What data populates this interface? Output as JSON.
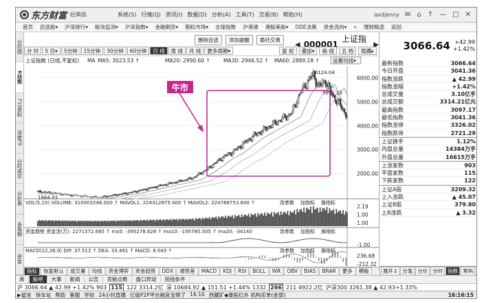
{
  "app": {
    "brand": "东方财富",
    "edition": "经典版",
    "menus": [
      "系统(S)",
      "行情(Q)",
      "资讯(I)",
      "数据(D)",
      "分析(A)",
      "工具(T)",
      "交易(B)",
      "帮助(H)"
    ],
    "user": "axdjenny",
    "window_controls": [
      "✉",
      "⌂",
      "↑",
      "—",
      "□",
      "✕"
    ]
  },
  "nav": [
    "首页",
    "自选股▾",
    "沪深排行▾",
    "板块监测▾",
    "沪深指数▾",
    "金融期货▾",
    "期权市场▾",
    "全球指数",
    "沪港通",
    "港股美股▾",
    "DDE决策",
    "资金流向▾",
    "»",
    "理财精选",
    "返回"
  ],
  "side_tabs": [
    "分时图",
    "K线图",
    "F10资料",
    "深度F9",
    "分时成交",
    "分价表",
    "多周期",
    "资金"
  ],
  "side_active": 1,
  "toolbar": {
    "buttons": [
      "删除自选",
      "添加提醒",
      "委托交易"
    ],
    "code": "000001",
    "name": "上证指数",
    "price": "3066.64",
    "change": "+42.99",
    "change_pct": "+1.42%"
  },
  "periods": [
    "分 时",
    "5 日▾",
    "5分钟",
    "15分钟",
    "30分钟",
    "60分钟",
    "日 线",
    "周 线",
    "月 线",
    "更多周期▾"
  ],
  "period_active": 6,
  "right_tools": [
    "复 权",
    "叠加▾",
    "画 线",
    "五 档",
    "隐藏▸"
  ],
  "chart": {
    "legend": {
      "title": "上证指数 (日线,不复权)",
      "ma": [
        "MA",
        "MA5: 3023.53 ↑",
        "MA10: 2964.54 ↑",
        "MA20: 2990.60 ↑",
        "MA30: 2946.52 ↑",
        "MA60: 2889.18 ↑"
      ],
      "setting": "设置均线▾"
    },
    "annotation": "牛市",
    "labels": {
      "high": "6124.04",
      "low": "1664.93",
      "mid": "5891.15"
    },
    "vol": {
      "legend": "VOL(5,10)",
      "volume": "VOLUME: 310003246.000 ↑",
      "mavol1": "MAVOL1: 224312875.400 ↑",
      "mavol2": "MAVOL2: 224788753.600 ↑",
      "buttons": [
        "改参数",
        "加指标",
        "换指标"
      ],
      "axis": [
        "2.19",
        "1.00",
        "1.00"
      ]
    },
    "fund": {
      "legend": "资金趋势",
      "line": "资金流(万): 2271572.685 ↑ ma5: -395278.628 ↑ ma10: -195785.505 ↑ ma20: -34140",
      "buttons": [
        "改参数",
        "加指标",
        "换指标"
      ],
      "axis": [
        "-1.00"
      ]
    },
    "macd": {
      "legend": "MACD(12,26,9)",
      "dif": "DIF: 37.512 ↑",
      "dea": "DEA: 33.491 ↑",
      "macd": "MACD: 8.043 ↑",
      "buttons": [
        "改参数",
        "加指标",
        "换指标"
      ],
      "axis": [
        "236.68",
        "-212.32"
      ]
    },
    "x_labels": [
      "2006",
      "2007",
      "2008"
    ]
  },
  "chart_data": {
    "type": "line",
    "title": "上证指数",
    "x_range": [
      "2005-01",
      "2008-02"
    ],
    "y_ticks": [
      2000,
      3000,
      4000,
      5000,
      6000
    ],
    "ylim": [
      1000,
      6500
    ],
    "series": [
      {
        "x": [
          0,
          0.05,
          0.1,
          0.15,
          0.2,
          0.25,
          0.3,
          0.35,
          0.4,
          0.45,
          0.5,
          0.55,
          0.6,
          0.63,
          0.66,
          0.7,
          0.74,
          0.78,
          0.82,
          0.85,
          0.87,
          0.89,
          0.91,
          0.93,
          0.95,
          0.97,
          1.0
        ],
        "values": [
          1250,
          1180,
          1100,
          1050,
          1000,
          1100,
          1200,
          1350,
          1500,
          1650,
          1800,
          2200,
          2700,
          2900,
          3200,
          3600,
          3900,
          4200,
          4500,
          5400,
          5800,
          6124,
          5600,
          5900,
          5300,
          5000,
          4400
        ]
      }
    ],
    "grid": true
  },
  "indicator_tabs": [
    "指标",
    "恢复默认",
    "成交量",
    "均线",
    "资金博弈",
    "资金趋势",
    "DDX",
    "顺势差",
    "MACD",
    "KDJ",
    "RSI",
    "BOLL",
    "WR",
    "OBV",
    "BIAS",
    "BRAR",
    "更多",
    "模板"
  ],
  "indicator_active": 0,
  "right_panel": {
    "stats1": [
      {
        "k": "最新指数",
        "v": "3066.64"
      },
      {
        "k": "今日开盘",
        "v": "3041.36"
      },
      {
        "k": "指数涨跌",
        "v": "▲ 42.99"
      },
      {
        "k": "指数涨幅",
        "v": "+1.42%"
      },
      {
        "k": "总成交量",
        "v": "3.10亿手"
      },
      {
        "k": "总成交额",
        "v": "3314.21亿元"
      },
      {
        "k": "最高指数",
        "v": "3097.17"
      },
      {
        "k": "最低指数",
        "v": "3041.36"
      },
      {
        "k": "指数涨停",
        "v": "3326.02"
      },
      {
        "k": "指数跌停",
        "v": "2721.29"
      }
    ],
    "stats2": [
      {
        "k": "上证换手",
        "v": "1.12%"
      },
      {
        "k": "内盘总量",
        "v": "14384万手"
      },
      {
        "k": "外盘总量",
        "v": "16615万手"
      }
    ],
    "stats3": [
      {
        "k": "上涨家数",
        "v": "903"
      },
      {
        "k": "平盘家数",
        "v": "115"
      },
      {
        "k": "下跌家数",
        "v": "122"
      }
    ],
    "stats4": [
      {
        "k": "上证A股",
        "v": "3209.32"
      },
      {
        "k": "上入涨跌",
        "v": "▲ 45.07"
      },
      {
        "k": "上证B股",
        "v": "379.80"
      },
      {
        "k": "上B涨跌",
        "v": "▲ 3.32"
      }
    ],
    "tabs": [
      "展开↕",
      "分笔",
      "分价",
      "分时",
      "指数",
      "筹码"
    ],
    "tabs_active": 4
  },
  "bottom_tabs": [
    "席",
    "股吧",
    "大事",
    "新闻",
    "公告",
    "贡献点数",
    "盘口异动",
    "短线条件"
  ],
  "bottom_active": 1,
  "ticker": {
    "sh": "沪 3066.64 ▲ 42.99 +1.42% 903",
    "sh_box": "115",
    "sh_rest": "122 3314.2亿",
    "sz": "深 10684.92 ▲ 151.51 +1.44% 1332",
    "sz_box": "266",
    "sz_rest": "211 4922.2亿",
    "hs300": "沪深300 3261.38 ▲ 42.93+1.33%"
  },
  "status": {
    "items": [
      "▶留言",
      "快车站",
      "帮助",
      "客服",
      "学校",
      "24小时直播",
      "亿级P2P平台融宜宝倒了",
      "16:10",
      "西藏矿◆康拓红外 机构买单(金部)"
    ],
    "time": "16:16:15"
  }
}
